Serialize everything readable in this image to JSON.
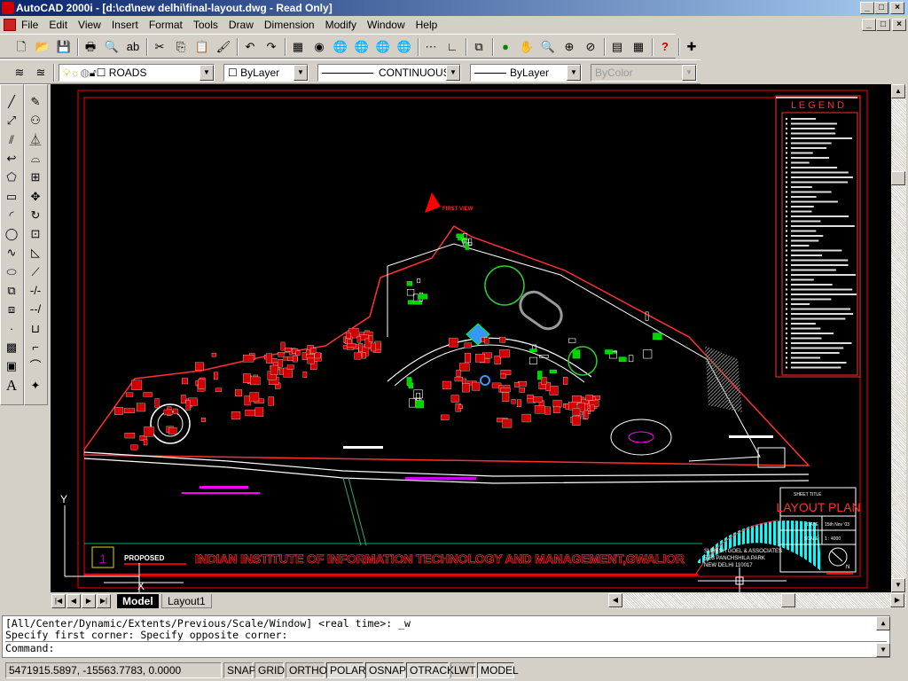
{
  "window": {
    "title": "AutoCAD 2000i - [d:\\cd\\new delhi\\final-layout.dwg - Read Only]",
    "controls": [
      "_",
      "□",
      "×"
    ]
  },
  "menu": [
    "File",
    "Edit",
    "View",
    "Insert",
    "Format",
    "Tools",
    "Draw",
    "Dimension",
    "Modify",
    "Window",
    "Help"
  ],
  "standard_toolbar": [
    "new-icon",
    "open-icon",
    "save-icon",
    "print-icon",
    "print-preview-icon",
    "spelling-icon",
    "cut-icon",
    "copy-icon",
    "paste-icon",
    "match-properties-icon",
    "undo-icon",
    "redo-icon",
    "today-icon",
    "autocad-today-icon",
    "meet-now-icon",
    "publish-to-web-icon",
    "etransmit-icon",
    "hyperlink-icon",
    "tracking-icon",
    "ucs-icon",
    "named-views-icon",
    "3d-orbit-icon",
    "pan-icon",
    "zoom-realtime-icon",
    "zoom-window-icon",
    "zoom-previous-icon",
    "properties-icon",
    "design-center-icon",
    "help-icon",
    "snap-icon"
  ],
  "properties_toolbar": {
    "layer": "ROADS",
    "color": "ByLayer",
    "linetype": "CONTINUOUS",
    "lineweight": "ByLayer",
    "plotstyle": "ByColor"
  },
  "draw_toolbar": [
    "line",
    "construction-line",
    "multiline",
    "polyline",
    "polygon",
    "rectangle",
    "arc",
    "circle",
    "spline",
    "ellipse",
    "insert-block",
    "make-block",
    "point",
    "hatch",
    "region",
    "multiline-text"
  ],
  "modify_toolbar": [
    "erase",
    "copy",
    "mirror",
    "offset",
    "array",
    "move",
    "rotate",
    "scale",
    "stretch",
    "lengthen",
    "trim",
    "extend",
    "break",
    "chamfer",
    "fillet",
    "explode"
  ],
  "drawing": {
    "title": "INDIAN INSTITUTE OF INFORMATION TECHNOLOGY AND MANAGEMENT,GWALIOR",
    "proposed": "PROPOSED",
    "sheet_no": "1",
    "legend": "L E G E N D",
    "arrow_label": "FIRST VIEW",
    "sheet_title_label": "SHEET TITLE",
    "sheet_title": "LAYOUT PLAN",
    "date_label": "DATE",
    "date": "15th Nov '03",
    "scale_label": "SCALE",
    "scale": "1 : 4000",
    "architect": [
      "SURESH GOEL & ASSOCIATES",
      "5-63 PANCHSHILA PARK",
      "NEW DELHI 110017"
    ],
    "north": "N",
    "ucs": {
      "x": "X",
      "y": "Y"
    },
    "colors": {
      "background": "#000000",
      "border": "#ff0000",
      "buildings": "#e00000",
      "green": "#00ff00",
      "roads": "#ffffff",
      "hatch": "#00ffff",
      "labels": "#ff00ff"
    }
  },
  "tabs": [
    {
      "label": "Model",
      "active": true
    },
    {
      "label": "Layout1",
      "active": false
    }
  ],
  "command": {
    "lines": [
      "[All/Center/Dynamic/Extents/Previous/Scale/Window] <real time>: _w",
      "Specify first corner: Specify opposite corner:"
    ],
    "prompt": "Command:"
  },
  "status": {
    "coords": "5471915.5897, -15563.7783, 0.0000",
    "toggles": [
      {
        "label": "SNAP",
        "on": false
      },
      {
        "label": "GRID",
        "on": false
      },
      {
        "label": "ORTHO",
        "on": false
      },
      {
        "label": "POLAR",
        "on": true
      },
      {
        "label": "OSNAP",
        "on": true
      },
      {
        "label": "OTRACK",
        "on": true
      },
      {
        "label": "LWT",
        "on": false
      },
      {
        "label": "MODEL",
        "on": true
      }
    ]
  }
}
